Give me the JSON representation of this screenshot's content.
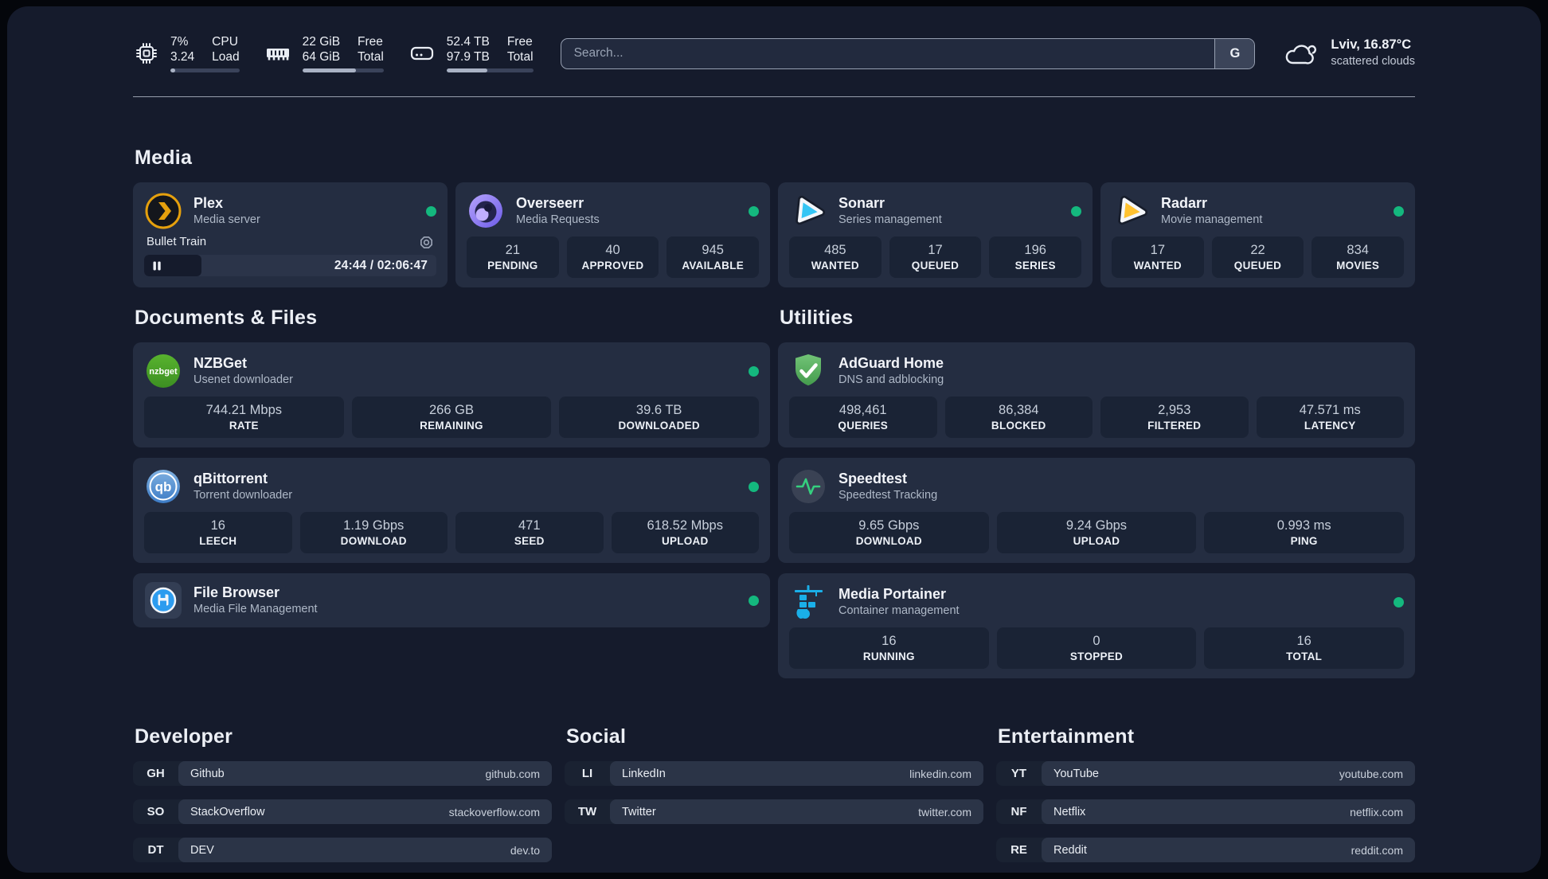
{
  "colors": {
    "background": "#151B2C",
    "card": "#242D41",
    "tile": "#1A2335",
    "status_online": "#14B87E",
    "plex_brand": "#E5A00D",
    "overseerr_brand": "#7C66EC",
    "sonarr_brand": "#35C5F4",
    "radarr_brand": "#FFC230",
    "nzbget_brand": "#4AA32B",
    "qbittorrent_brand": "#4C8FD0",
    "adguard_brand": "#4CAF50",
    "speedtest_pulse": "#35D07F",
    "portainer_brand": "#1AAFE8",
    "filebrowser_brand": "#2D9CEF"
  },
  "header": {
    "stats": [
      {
        "name": "cpu",
        "values": [
          "7%",
          "3.24"
        ],
        "labels": [
          "CPU",
          "Load"
        ],
        "progress": 7
      },
      {
        "name": "memory",
        "values": [
          "22 GiB",
          "64 GiB"
        ],
        "labels": [
          "Free",
          "Total"
        ],
        "progress": 66
      },
      {
        "name": "disk",
        "values": [
          "52.4 TB",
          "97.9 TB"
        ],
        "labels": [
          "Free",
          "Total"
        ],
        "progress": 47
      }
    ],
    "search": {
      "placeholder": "Search...",
      "engine_label": "G"
    },
    "weather": {
      "title": "Lviv, 16.87°C",
      "subtitle": "scattered clouds"
    }
  },
  "sections": {
    "media": {
      "title": "Media",
      "plex": {
        "name": "Plex",
        "desc": "Media server",
        "status": "online",
        "player": {
          "track": "Bullet Train",
          "time": "24:44 / 02:06:47",
          "progress_pct": 19.5
        }
      },
      "overseerr": {
        "name": "Overseerr",
        "desc": "Media Requests",
        "status": "online",
        "stats": [
          {
            "value": "21",
            "label": "PENDING"
          },
          {
            "value": "40",
            "label": "APPROVED"
          },
          {
            "value": "945",
            "label": "AVAILABLE"
          }
        ]
      },
      "sonarr": {
        "name": "Sonarr",
        "desc": "Series management",
        "status": "online",
        "stats": [
          {
            "value": "485",
            "label": "WANTED"
          },
          {
            "value": "17",
            "label": "QUEUED"
          },
          {
            "value": "196",
            "label": "SERIES"
          }
        ]
      },
      "radarr": {
        "name": "Radarr",
        "desc": "Movie management",
        "status": "online",
        "stats": [
          {
            "value": "17",
            "label": "WANTED"
          },
          {
            "value": "22",
            "label": "QUEUED"
          },
          {
            "value": "834",
            "label": "MOVIES"
          }
        ]
      }
    },
    "documents": {
      "title": "Documents & Files",
      "nzbget": {
        "name": "NZBGet",
        "desc": "Usenet downloader",
        "status": "online",
        "stats": [
          {
            "value": "744.21 Mbps",
            "label": "RATE"
          },
          {
            "value": "266 GB",
            "label": "REMAINING"
          },
          {
            "value": "39.6 TB",
            "label": "DOWNLOADED"
          }
        ]
      },
      "qbittorrent": {
        "name": "qBittorrent",
        "desc": "Torrent downloader",
        "status": "online",
        "stats": [
          {
            "value": "16",
            "label": "LEECH"
          },
          {
            "value": "1.19 Gbps",
            "label": "DOWNLOAD"
          },
          {
            "value": "471",
            "label": "SEED"
          },
          {
            "value": "618.52 Mbps",
            "label": "UPLOAD"
          }
        ]
      },
      "filebrowser": {
        "name": "File Browser",
        "desc": "Media File Management",
        "status": "online"
      }
    },
    "utilities": {
      "title": "Utilities",
      "adguard": {
        "name": "AdGuard Home",
        "desc": "DNS and adblocking",
        "stats": [
          {
            "value": "498,461",
            "label": "QUERIES"
          },
          {
            "value": "86,384",
            "label": "BLOCKED"
          },
          {
            "value": "2,953",
            "label": "FILTERED"
          },
          {
            "value": "47.571 ms",
            "label": "LATENCY"
          }
        ]
      },
      "speedtest": {
        "name": "Speedtest",
        "desc": "Speedtest Tracking",
        "stats": [
          {
            "value": "9.65 Gbps",
            "label": "DOWNLOAD"
          },
          {
            "value": "9.24 Gbps",
            "label": "UPLOAD"
          },
          {
            "value": "0.993 ms",
            "label": "PING"
          }
        ]
      },
      "portainer": {
        "name": "Media Portainer",
        "desc": "Container management",
        "status": "online",
        "stats": [
          {
            "value": "16",
            "label": "RUNNING"
          },
          {
            "value": "0",
            "label": "STOPPED"
          },
          {
            "value": "16",
            "label": "TOTAL"
          }
        ]
      }
    }
  },
  "links": {
    "developer": {
      "title": "Developer",
      "items": [
        {
          "tag": "GH",
          "name": "Github",
          "url": "github.com"
        },
        {
          "tag": "SO",
          "name": "StackOverflow",
          "url": "stackoverflow.com"
        },
        {
          "tag": "DT",
          "name": "DEV",
          "url": "dev.to"
        }
      ]
    },
    "social": {
      "title": "Social",
      "items": [
        {
          "tag": "LI",
          "name": "LinkedIn",
          "url": "linkedin.com"
        },
        {
          "tag": "TW",
          "name": "Twitter",
          "url": "twitter.com"
        }
      ]
    },
    "entertainment": {
      "title": "Entertainment",
      "items": [
        {
          "tag": "YT",
          "name": "YouTube",
          "url": "youtube.com"
        },
        {
          "tag": "NF",
          "name": "Netflix",
          "url": "netflix.com"
        },
        {
          "tag": "RE",
          "name": "Reddit",
          "url": "reddit.com"
        }
      ]
    }
  }
}
